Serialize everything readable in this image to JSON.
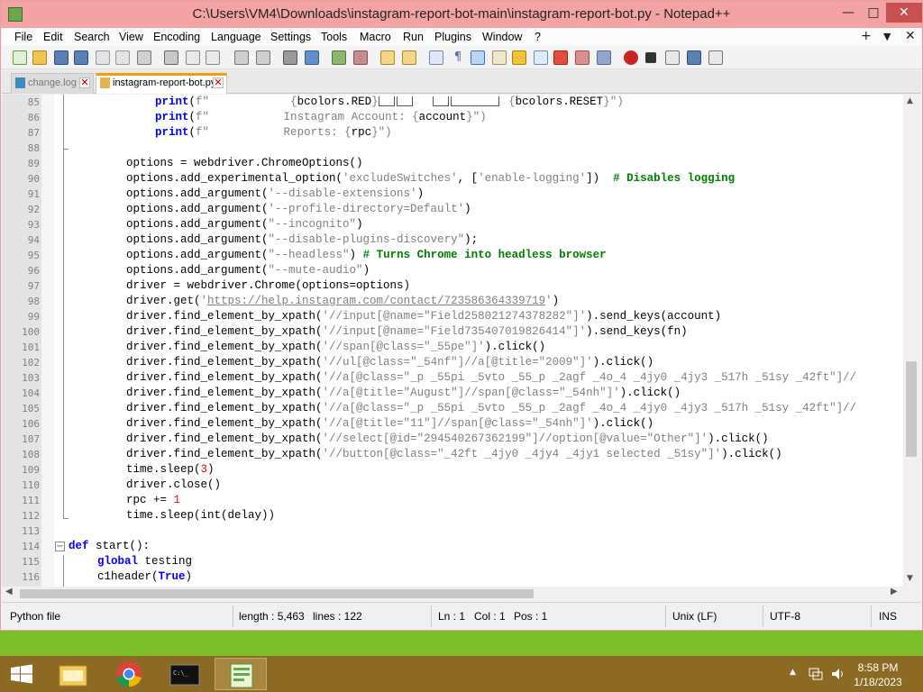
{
  "window": {
    "title": "C:\\Users\\VM4\\Downloads\\instagram-report-bot-main\\instagram-report-bot.py - Notepad++",
    "minimize": "—",
    "maximize": "□",
    "close": "✕"
  },
  "menu": {
    "items": [
      "File",
      "Edit",
      "Search",
      "View",
      "Encoding",
      "Language",
      "Settings",
      "Tools",
      "Macro",
      "Run",
      "Plugins",
      "Window",
      "?"
    ],
    "right": [
      "+",
      "▼",
      "✕"
    ]
  },
  "tabs": [
    {
      "label": "change.log",
      "active": false
    },
    {
      "label": "instagram-report-bot.py",
      "active": true
    }
  ],
  "editor": {
    "lines": [
      {
        "n": "85"
      },
      {
        "n": "86"
      },
      {
        "n": "87"
      },
      {
        "n": "88"
      },
      {
        "n": "89"
      },
      {
        "n": "90"
      },
      {
        "n": "91"
      },
      {
        "n": "92"
      },
      {
        "n": "93"
      },
      {
        "n": "94"
      },
      {
        "n": "95"
      },
      {
        "n": "96"
      },
      {
        "n": "97"
      },
      {
        "n": "98"
      },
      {
        "n": "99"
      },
      {
        "n": "100"
      },
      {
        "n": "101"
      },
      {
        "n": "102"
      },
      {
        "n": "103"
      },
      {
        "n": "104"
      },
      {
        "n": "105"
      },
      {
        "n": "106"
      },
      {
        "n": "107"
      },
      {
        "n": "108"
      },
      {
        "n": "109"
      },
      {
        "n": "110"
      },
      {
        "n": "111"
      },
      {
        "n": "112"
      },
      {
        "n": "113"
      },
      {
        "n": "114"
      },
      {
        "n": "115"
      },
      {
        "n": "116"
      }
    ],
    "code": {
      "l85": [
        "print",
        "(",
        "f\"",
        "            {",
        "bcolors.RED",
        "}",
        "",
        "",
        "   ",
        "",
        "{",
        "bcolors.RESET",
        "}",
        "\")"
      ],
      "l86": [
        "print",
        "(",
        "f\"",
        "           Instagram Account: {",
        "account",
        "}",
        "\")"
      ],
      "l87": [
        "print",
        "(",
        "f\"",
        "           Reports: {",
        "rpc",
        "}",
        "\")"
      ],
      "l89": "options = webdriver.ChromeOptions()",
      "l90a": "options.add_experimental_option(",
      "l90b": "'excludeSwitches'",
      "l90c": ", [",
      "l90d": "'enable-logging'",
      "l90e": "])  ",
      "l90f": "# Disables logging",
      "l91a": "options.add_argument(",
      "l91b": "'--disable-extensions'",
      "l91c": ")",
      "l92b": "'--profile-directory=Default'",
      "l93b": "\"--incognito\"",
      "l94b": "\"--disable-plugins-discovery\"",
      "l94c": ");",
      "l95b": "\"--headless\"",
      "l95c": ") ",
      "l95d": "# Turns Chrome into headless browser",
      "l96b": "\"--mute-audio\"",
      "l97": "driver = webdriver.Chrome(options=options)",
      "l98a": "driver.get(",
      "l98b": "'",
      "l98url": "https://help.instagram.com/contact/723586364339719",
      "l98c": "'",
      "l98d": ")",
      "xpath": "driver.find_element_by_xpath(",
      "l99b": "'//input[@name=\"Field258021274378282\"]'",
      "l99c": ").send_keys(account)",
      "l100b": "'//input[@name=\"Field735407019826414\"]'",
      "l100c": ").send_keys(fn)",
      "l101b": "'//span[@class=\"_55pe\"]'",
      "click": ").click()",
      "l102b": "'//ul[@class=\"_54nf\"]//a[@title=\"2009\"]'",
      "l103b": "'//a[@class=\"_p _55pi _5vto _55_p _2agf _4o_4 _4jy0 _4jy3 _517h _51sy _42ft\"]//",
      "l104b": "'//a[@title=\"August\"]//span[@class=\"_54nh\"]'",
      "l105b": "'//a[@class=\"_p _55pi _5vto _55_p _2agf _4o_4 _4jy0 _4jy3 _517h _51sy _42ft\"]//",
      "l106b": "'//a[@title=\"11\"]//span[@class=\"_54nh\"]'",
      "l107b": "'//select[@id=\"294540267362199\"]//option[@value=\"Other\"]'",
      "l108b": "'//button[@class=\"_42ft _4jy0 _4jy4 _4jy1 selected _51sy\"]'",
      "l109a": "time.sleep(",
      "l109b": "3",
      "l109c": ")",
      "l110": "driver.close()",
      "l111a": "rpc += ",
      "l111b": "1",
      "l112": "time.sleep(int(delay))",
      "l114a": "def",
      "l114b": " start():",
      "l115a": "global",
      "l115b": " testing",
      "l116a": "c1header(",
      "l116b": "True",
      "l116c": ")"
    }
  },
  "status": {
    "filetype": "Python file",
    "length": "length : 5,463",
    "lines": "lines : 122",
    "ln": "Ln : 1",
    "col": "Col : 1",
    "pos": "Pos : 1",
    "eol": "Unix (LF)",
    "encoding": "UTF-8",
    "mode": "INS"
  },
  "taskbar": {
    "time": "8:58 PM",
    "date": "1/18/2023",
    "cmd_label": "C:\\_"
  }
}
